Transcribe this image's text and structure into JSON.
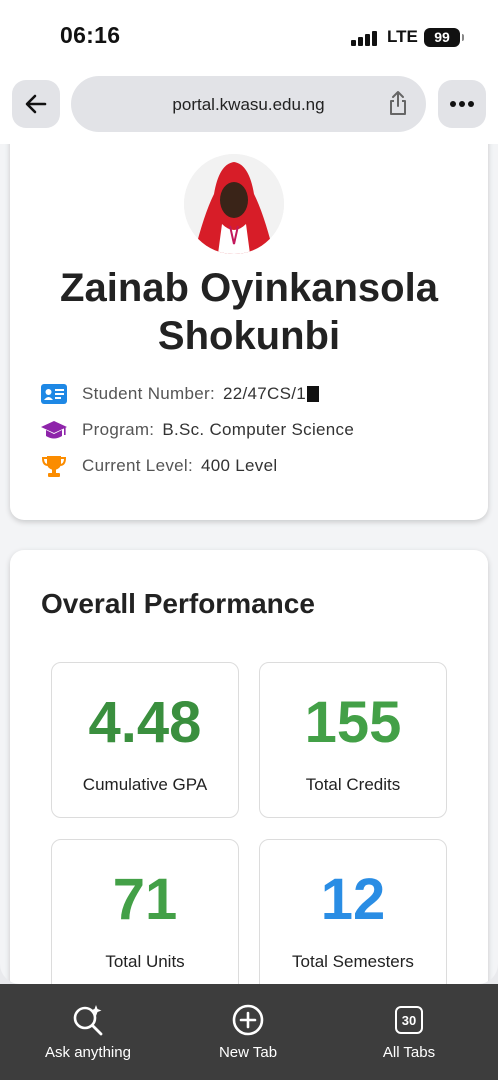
{
  "status_bar": {
    "time": "06:16",
    "network": "LTE",
    "battery": "99"
  },
  "browser": {
    "url": "portal.kwasu.edu.ng",
    "toolbar": {
      "ask_label": "Ask anything",
      "new_tab_label": "New Tab",
      "all_tabs_label": "All Tabs",
      "tab_count": "30"
    }
  },
  "profile": {
    "name": "Zainab Oyinkansola Shokunbi",
    "student_number_label": "Student Number:",
    "student_number": "22/47CS/1",
    "program_label": "Program:",
    "program": "B.Sc. Computer Science",
    "level_label": "Current Level:",
    "level": "400 Level"
  },
  "performance": {
    "title": "Overall Performance",
    "stats": [
      {
        "value": "4.48",
        "label": "Cumulative GPA",
        "color": "#3a8f3e"
      },
      {
        "value": "155",
        "label": "Total Credits",
        "color": "#43a047"
      },
      {
        "value": "71",
        "label": "Total Units",
        "color": "#43a047"
      },
      {
        "value": "12",
        "label": "Total Semesters",
        "color": "#2a8de4"
      }
    ]
  },
  "colors": {
    "icon_blue": "#1e88e5",
    "icon_purple": "#8e24aa",
    "icon_orange": "#fb8c00"
  }
}
